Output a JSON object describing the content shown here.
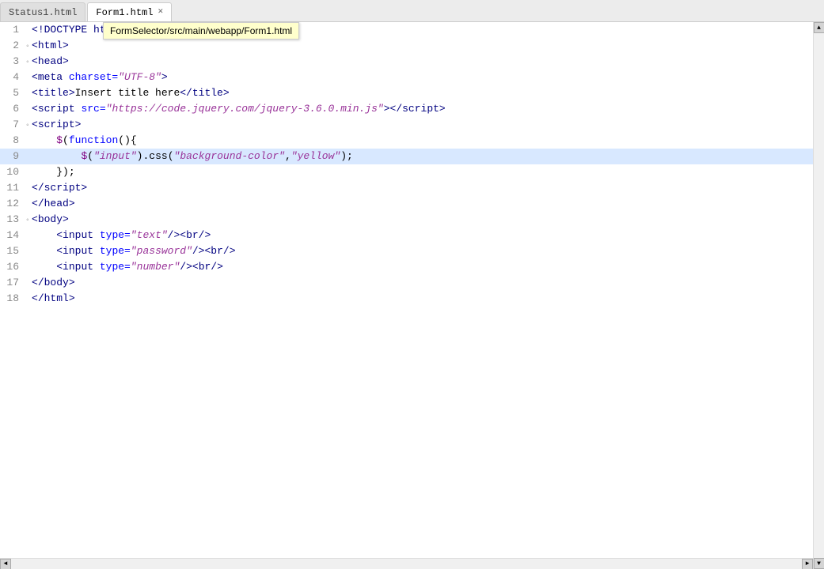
{
  "tabs": [
    {
      "id": "status1",
      "label": "Status1.html",
      "active": false,
      "closeable": false
    },
    {
      "id": "form1",
      "label": "Form1.html",
      "active": true,
      "closeable": true
    }
  ],
  "tooltip": {
    "text": "FormSelector/src/main/webapp/Form1.html"
  },
  "lines": [
    {
      "num": "1",
      "fold": "",
      "content_id": "line1",
      "highlighted": false
    },
    {
      "num": "2",
      "fold": "◦",
      "content_id": "line2",
      "highlighted": false
    },
    {
      "num": "3",
      "fold": "◦",
      "content_id": "line3",
      "highlighted": false
    },
    {
      "num": "4",
      "fold": "",
      "content_id": "line4",
      "highlighted": false
    },
    {
      "num": "5",
      "fold": "",
      "content_id": "line5",
      "highlighted": false
    },
    {
      "num": "6",
      "fold": "",
      "content_id": "line6",
      "highlighted": false
    },
    {
      "num": "7",
      "fold": "◦",
      "content_id": "line7",
      "highlighted": false
    },
    {
      "num": "8",
      "fold": "",
      "content_id": "line8",
      "highlighted": false
    },
    {
      "num": "9",
      "fold": "",
      "content_id": "line9",
      "highlighted": true
    },
    {
      "num": "10",
      "fold": "",
      "content_id": "line10",
      "highlighted": false
    },
    {
      "num": "11",
      "fold": "",
      "content_id": "line11",
      "highlighted": false
    },
    {
      "num": "12",
      "fold": "",
      "content_id": "line12",
      "highlighted": false
    },
    {
      "num": "13",
      "fold": "◦",
      "content_id": "line13",
      "highlighted": false
    },
    {
      "num": "14",
      "fold": "",
      "content_id": "line14",
      "highlighted": false
    },
    {
      "num": "15",
      "fold": "",
      "content_id": "line15",
      "highlighted": false
    },
    {
      "num": "16",
      "fold": "",
      "content_id": "line16",
      "highlighted": false
    },
    {
      "num": "17",
      "fold": "",
      "content_id": "line17",
      "highlighted": false
    },
    {
      "num": "18",
      "fold": "",
      "content_id": "line18",
      "highlighted": false
    }
  ],
  "scrollbar": {
    "up_arrow": "▲",
    "down_arrow": "▼",
    "left_arrow": "◄",
    "right_arrow": "►"
  }
}
